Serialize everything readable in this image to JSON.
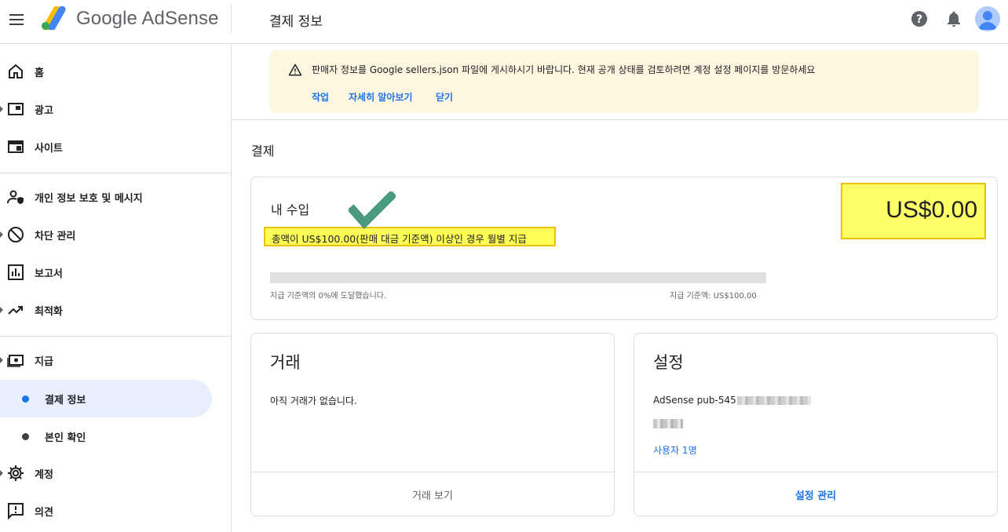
{
  "header": {
    "brand": "Google AdSense",
    "page_title": "결제 정보",
    "icons": [
      "menu-icon",
      "help-icon",
      "bell-icon",
      "avatar"
    ]
  },
  "sidebar": {
    "items": [
      {
        "label": "홈",
        "icon": "home-icon"
      },
      {
        "label": "광고",
        "icon": "ads-icon"
      },
      {
        "label": "사이트",
        "icon": "sites-icon"
      },
      {
        "label": "개인 정보 보호 및 메시지",
        "icon": "privacy-icon"
      },
      {
        "label": "차단 관리",
        "icon": "block-icon"
      },
      {
        "label": "보고서",
        "icon": "reports-icon"
      },
      {
        "label": "최적화",
        "icon": "trending-icon"
      },
      {
        "label": "지급",
        "icon": "payments-icon"
      },
      {
        "label": "결제 정보",
        "active": true
      },
      {
        "label": "본인 확인"
      },
      {
        "label": "계정",
        "icon": "gear-icon"
      },
      {
        "label": "의견",
        "icon": "feedback-icon"
      }
    ]
  },
  "banner": {
    "message": "판매자 정보를 Google sellers.json 파일에 게시하시기 바랍니다. 현재 공개 상태를 검토하려면 계정 설정 페이지를 방문하세요",
    "actions": [
      "작업",
      "자세히 알아보기",
      "닫기"
    ]
  },
  "main": {
    "section_title": "결제",
    "earnings": {
      "title": "내 수입",
      "description": "총액이 US$100.00(판매 대금 기준액) 이상인 경우 월별 지급",
      "amount": "US$0.00",
      "progress_fraction": 0,
      "progress_left": "지급 기준액의 0%에 도달했습니다.",
      "progress_right": "지급 기준액: US$100.00"
    },
    "transactions": {
      "title": "거래",
      "empty_text": "아직 거래가 없습니다.",
      "footer_button": "거래 보기"
    },
    "settings": {
      "title": "설정",
      "publisher_id": "AdSense pub-545",
      "users_link": "사용자 1명",
      "footer_button": "설정 관리"
    }
  },
  "colors": {
    "accent": "#1a73e8",
    "banner_bg": "#fef7e0",
    "highlight": "#ffff55",
    "active_nav_bg": "#e8f0fe",
    "check": "#4a9a7f"
  }
}
